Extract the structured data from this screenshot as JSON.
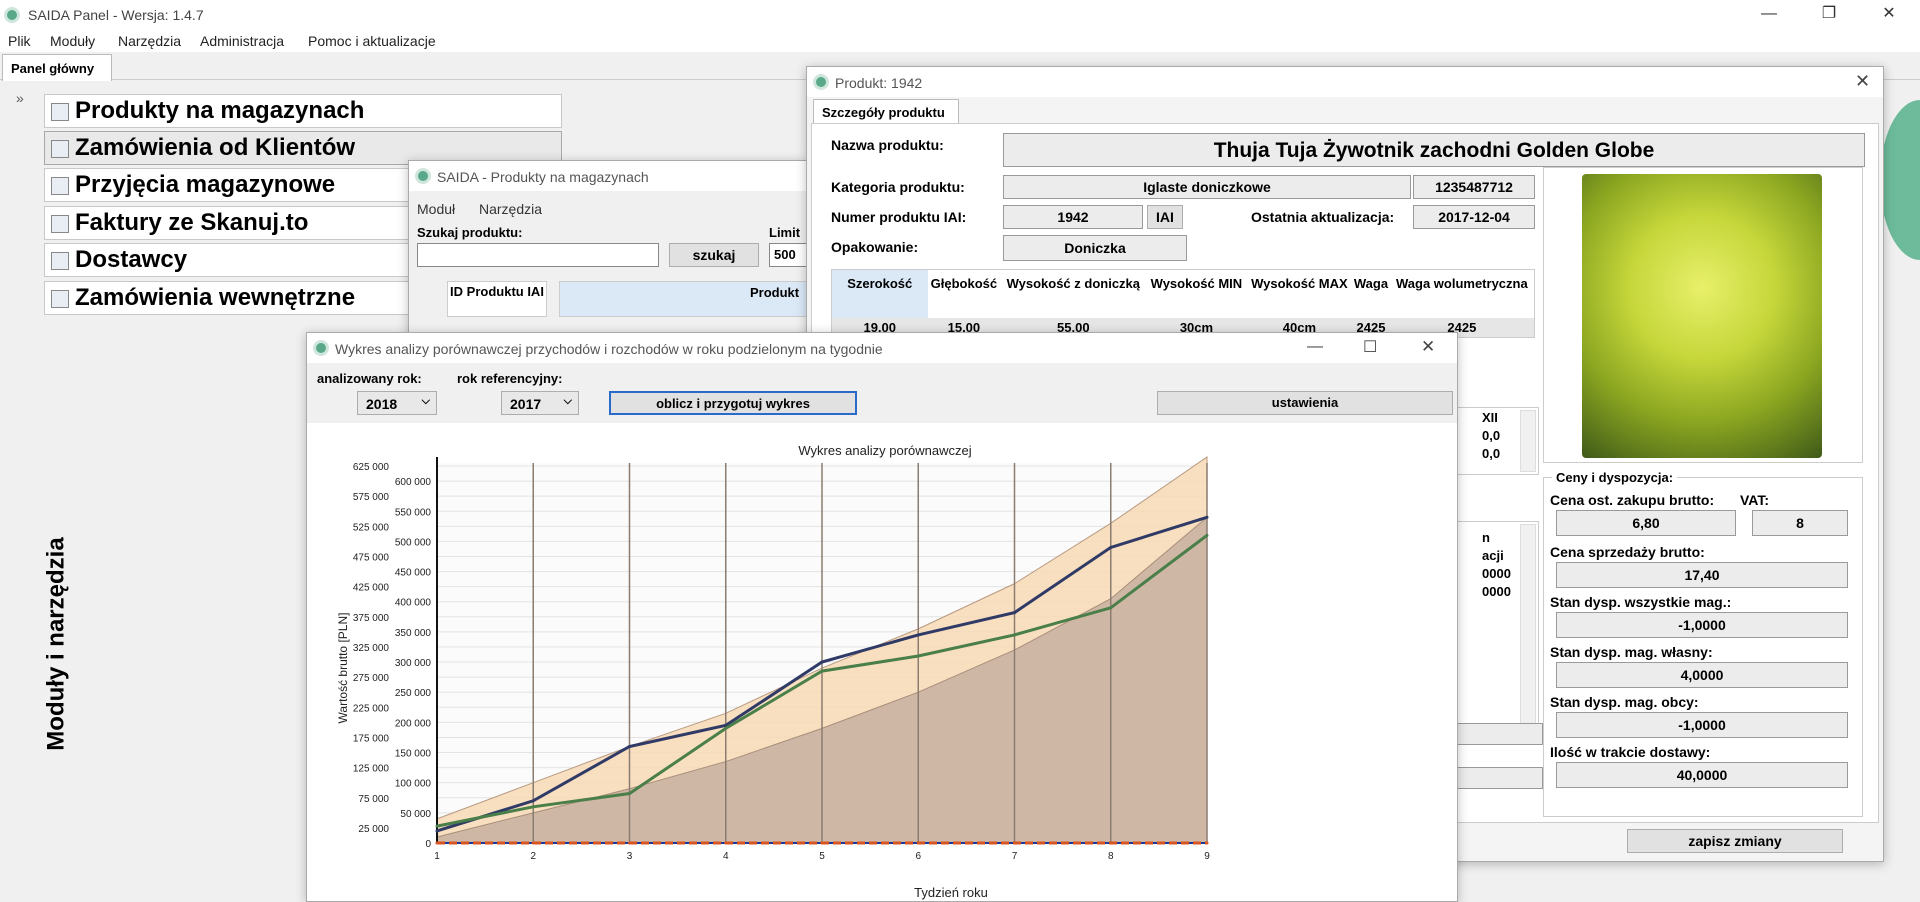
{
  "app": {
    "title": "SAIDA Panel - Wersja: 1.4.7",
    "menu": [
      "Plik",
      "Moduły",
      "Narzędzia",
      "Administracja",
      "Pomoc i aktualizacje"
    ],
    "tab": "Panel główny",
    "sidebar_label": "Moduły i narzędzia",
    "modules": [
      "Produkty na magazynach",
      "Zamówienia od Klientów",
      "Przyjęcia magazynowe",
      "Faktury ze Skanuj.to",
      "Dostawcy",
      "Zamówienia wewnętrzne"
    ]
  },
  "products_window": {
    "title": "SAIDA - Produkty na magazynach",
    "menu": [
      "Moduł",
      "Narzędzia"
    ],
    "search_label": "Szukaj produktu:",
    "search_button": "szukaj",
    "limit_label": "Limit",
    "limit_value": "500",
    "col_id": "ID Produktu IAI",
    "col_product": "Produkt"
  },
  "product_window": {
    "title": "Produkt: 1942",
    "tab": "Szczegóły produktu",
    "name_label": "Nazwa produktu:",
    "name": "Thuja Tuja Żywotnik zachodni Golden Globe",
    "category_label": "Kategoria produktu:",
    "category": "Iglaste doniczkowe",
    "category_code": "1235487712",
    "iai_label": "Numer produktu IAI:",
    "iai_number": "1942",
    "iai_button": "IAI",
    "update_label": "Ostatnia aktualizacja:",
    "update_date": "2017-12-04",
    "packaging_label": "Opakowanie:",
    "packaging": "Doniczka",
    "dims_headers": [
      "Szerokość",
      "Głębokość",
      "Wysokość z doniczką",
      "Wysokość MIN",
      "Wysokość MAX",
      "Waga",
      "Waga wolumetryczna"
    ],
    "dims_values": [
      "19,00",
      "15,00",
      "55,00",
      "30cm",
      "40cm",
      "2425",
      "2425"
    ],
    "partial_cells": [
      "XII",
      "0,0",
      "0,0",
      "n",
      "acji",
      "0000",
      "0000"
    ],
    "prices_label": "Ceny i dyspozycja:",
    "purchase_label": "Cena ost. zakupu brutto:",
    "purchase": "6,80",
    "vat_label": "VAT:",
    "vat": "8",
    "sale_label": "Cena sprzedaży brutto:",
    "sale": "17,40",
    "stock_all_label": "Stan dysp. wszystkie mag.:",
    "stock_all": "-1,0000",
    "stock_own_label": "Stan dysp. mag. własny:",
    "stock_own": "4,0000",
    "stock_ext_label": "Stan dysp. mag. obcy:",
    "stock_ext": "-1,0000",
    "in_delivery_label": "Ilość w trakcie dostawy:",
    "in_delivery": "40,0000",
    "save_button": "zapisz zmiany"
  },
  "chart_window": {
    "title": "Wykres analizy porównawczej przychodów i rozchodów w roku podzielonym na tygodnie",
    "year_label": "analizowany rok:",
    "year": "2018",
    "ref_label": "rok referencyjny:",
    "ref_year": "2017",
    "calc_button": "oblicz i przygotuj wykres",
    "settings_button": "ustawienia"
  },
  "chart_data": {
    "type": "line",
    "title": "Wykres analizy porównawczej",
    "xlabel": "Tydzień roku",
    "ylabel": "Wartość brutto [PLN]",
    "x": [
      1,
      2,
      3,
      4,
      5,
      6,
      7,
      8,
      9
    ],
    "ylim": [
      0,
      630000
    ],
    "y_ticks": [
      "0",
      "50 000",
      "100 000",
      "150 000",
      "200 000",
      "250 000",
      "300 000",
      "350 000",
      "400 000",
      "450 000",
      "500 000",
      "550 000",
      "600 000"
    ],
    "y_ticks_alt": [
      "25 000",
      "75 000",
      "125 000",
      "175 000",
      "225 000",
      "275 000",
      "325 000",
      "375 000",
      "425 000",
      "475 000",
      "525 000",
      "575 000",
      "625 000"
    ],
    "series": [
      {
        "values": [
          20000,
          70000,
          160000,
          195000,
          300000,
          345000,
          382000,
          490000,
          540000
        ],
        "color": "#2f3a66"
      },
      {
        "values": [
          28000,
          60000,
          82000,
          190000,
          285000,
          310000,
          345000,
          390000,
          510000
        ],
        "color": "#4a7f4a"
      },
      {
        "values": [
          0,
          0,
          0,
          0,
          0,
          0,
          0,
          0,
          0
        ],
        "color": "#d9541e"
      }
    ],
    "bands": [
      {
        "upper": [
          40000,
          100000,
          160000,
          215000,
          290000,
          355000,
          430000,
          530000,
          640000
        ],
        "color": "#f7d9b5"
      },
      {
        "upper": [
          10000,
          50000,
          90000,
          135000,
          190000,
          250000,
          320000,
          405000,
          540000
        ],
        "color": "#c8b0a0"
      }
    ],
    "grid": true,
    "legend": "none"
  }
}
